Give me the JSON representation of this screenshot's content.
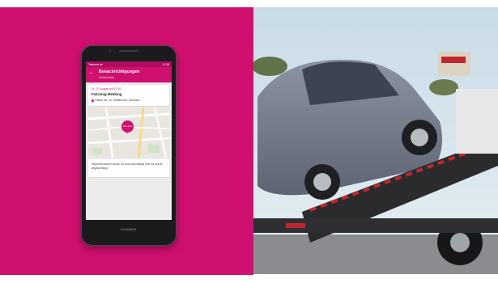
{
  "phone": {
    "brand": "HUAWEI",
    "status_left": "Telekom.de",
    "status_right": "12:08"
  },
  "app": {
    "title": "Benachrichtigungen",
    "subtitle": "Gehört Auto",
    "back_icon": "arrow-left-icon"
  },
  "info_card": {
    "date": "Di. 22. August um 10:10",
    "heading": "Fahrzeug-Meldung",
    "address": "Planer Str. 22, 50668 Köln, Deutschl..."
  },
  "map": {
    "marker_label": "Mein Auto"
  },
  "note_card": {
    "text": "Abgeschlossene wurde Ihr Auto beschädigt oder es wurde abgeschleppt."
  },
  "colors": {
    "magenta": "#d0106e",
    "magenta_dark": "#b00b5f"
  }
}
